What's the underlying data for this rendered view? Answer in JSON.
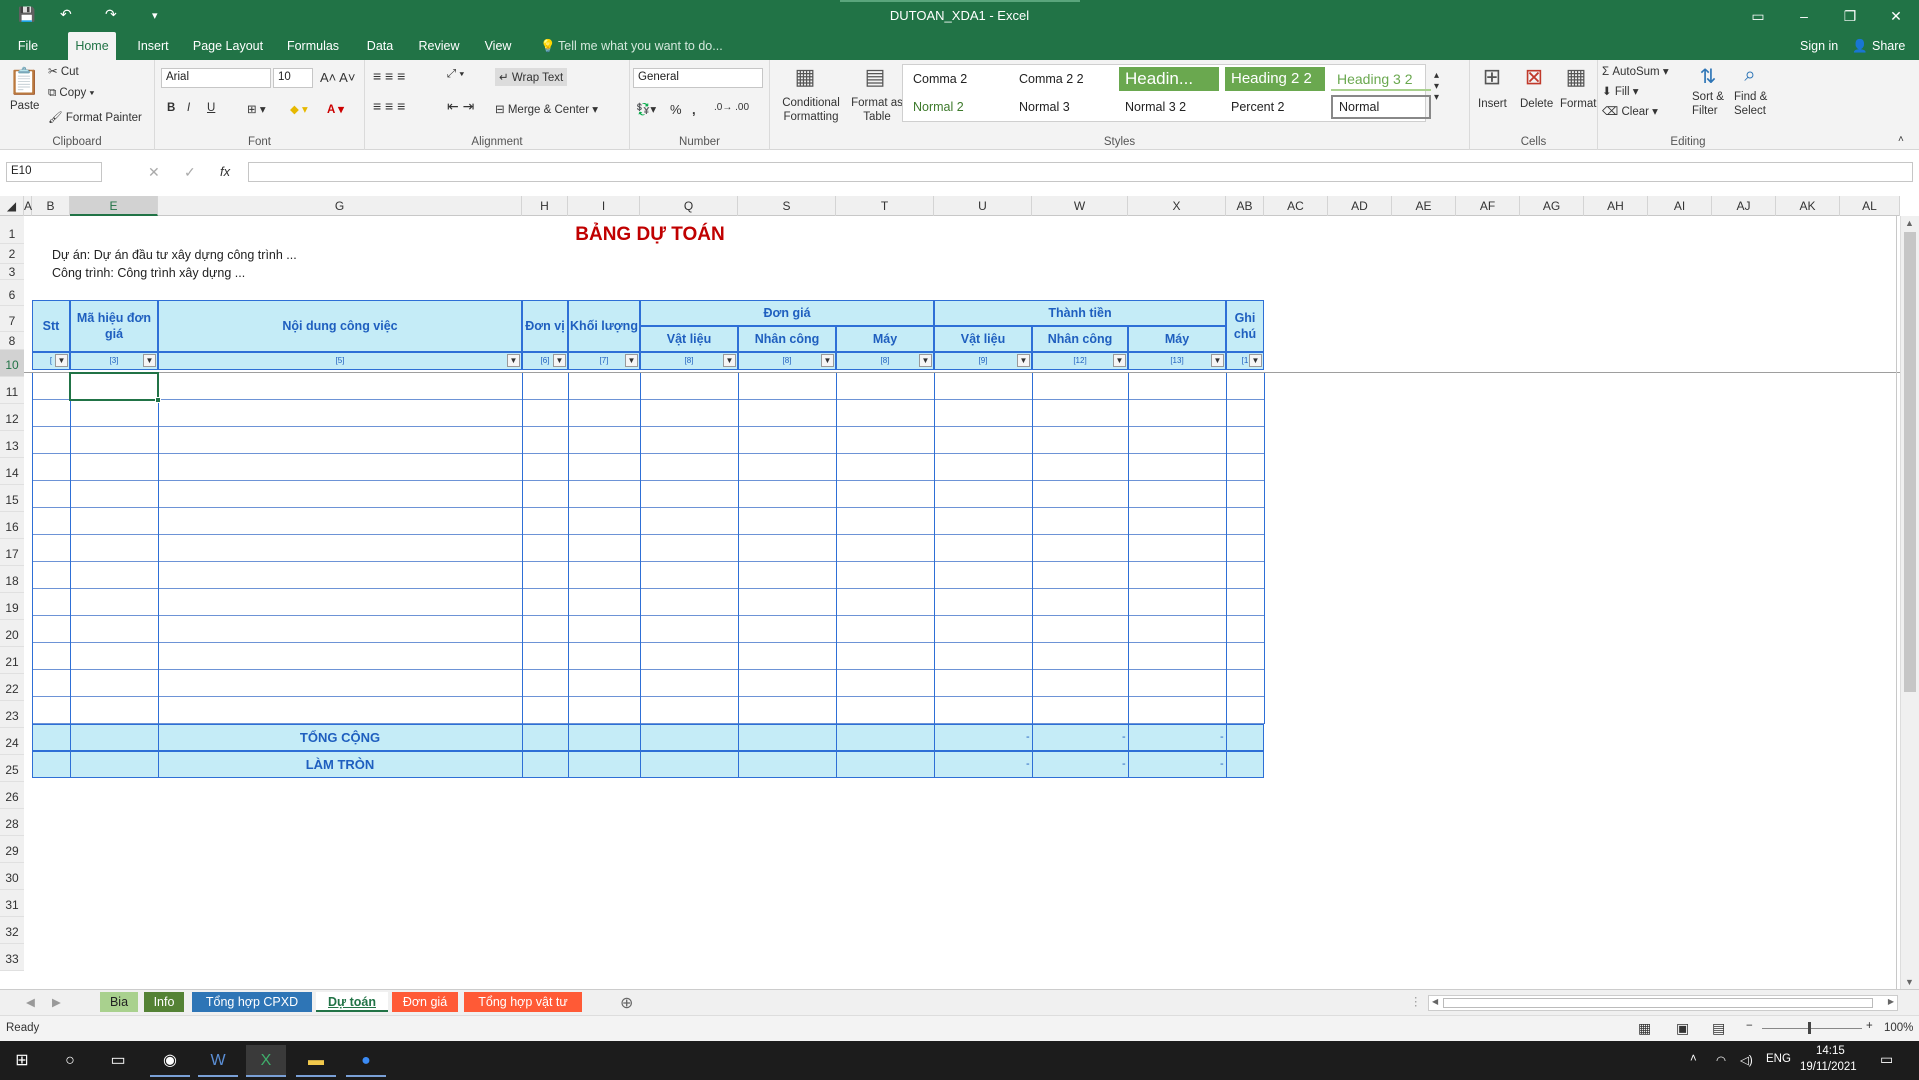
{
  "window": {
    "title": "DUTOAN_XDA1 - Excel",
    "minimize": "–",
    "restore": "❐",
    "close": "✕"
  },
  "quick_access": {
    "save": "💾",
    "undo": "↶",
    "redo": "↷",
    "more": "▾"
  },
  "ribbon_tabs": [
    "File",
    "Home",
    "Insert",
    "Page Layout",
    "Formulas",
    "Data",
    "Review",
    "View"
  ],
  "tell_me": "Tell me what you want to do...",
  "sign_in": "Sign in",
  "share": "Share",
  "clipboard": {
    "paste": "Paste",
    "cut": "Cut",
    "copy": "Copy",
    "format_painter": "Format Painter",
    "label": "Clipboard"
  },
  "font": {
    "name": "Arial",
    "size": "10",
    "label": "Font",
    "bold": "B",
    "italic": "I",
    "underline": "U"
  },
  "alignment": {
    "wrap_text": "Wrap Text",
    "merge_center": "Merge & Center",
    "label": "Alignment"
  },
  "number": {
    "format": "General",
    "percent": "%",
    "comma": ",",
    "label": "Number"
  },
  "styles": {
    "conditional": "Conditional Formatting",
    "format_table": "Format as Table",
    "cells": [
      {
        "label": "Comma 2"
      },
      {
        "label": "Comma 2 2"
      },
      {
        "label": "Headin..."
      },
      {
        "label": "Heading 2 2"
      },
      {
        "label": "Heading 3 2"
      },
      {
        "label": "Normal 2"
      },
      {
        "label": "Normal 3"
      },
      {
        "label": "Normal 3 2"
      },
      {
        "label": "Percent 2"
      },
      {
        "label": "Normal"
      }
    ],
    "label": "Styles"
  },
  "cells_group": {
    "insert": "Insert",
    "delete": "Delete",
    "format": "Format",
    "label": "Cells"
  },
  "editing": {
    "autosum": "AutoSum",
    "fill": "Fill",
    "clear": "Clear",
    "sort_filter": "Sort & Filter",
    "find_select": "Find & Select",
    "label": "Editing"
  },
  "formula_bar": {
    "name_box": "E10",
    "fx": "fx",
    "cancel": "✕",
    "enter": "✓",
    "formula": ""
  },
  "columns": [
    "A",
    "B",
    "E",
    "G",
    "H",
    "I",
    "Q",
    "S",
    "T",
    "U",
    "W",
    "X",
    "AB",
    "AC",
    "AD",
    "AE",
    "AF",
    "AG",
    "AH",
    "AI",
    "AJ",
    "AK",
    "AL"
  ],
  "rows": [
    "1",
    "2",
    "3",
    "6",
    "7",
    "8",
    "10",
    "11",
    "12",
    "13",
    "14",
    "15",
    "16",
    "17",
    "18",
    "19",
    "20",
    "21",
    "22",
    "23",
    "24",
    "25",
    "26",
    "28",
    "29",
    "30",
    "31",
    "32",
    "33"
  ],
  "sheet": {
    "title": "BẢNG DỰ TOÁN",
    "project": "Dự án: Dự án đầu tư xây dựng công trình ...",
    "construction": "Công trình: Công trình xây dựng ...",
    "headers": {
      "stt": "Stt",
      "ma_hieu": "Mã hiệu đơn giá",
      "noi_dung": "Nội dung công việc",
      "don_vi": "Đơn vị",
      "khoi_luong": "Khối lượng",
      "don_gia": "Đơn giá",
      "thanh_tien": "Thành tiền",
      "ghi_chu": "Ghi chú",
      "vat_lieu": "Vật liệu",
      "nhan_cong": "Nhân công",
      "may": "Máy"
    },
    "filter_row": [
      "[",
      "[3]",
      "[5]",
      "[6]",
      "[7]",
      "[8]",
      "[8]",
      "[8]",
      "[9]",
      "[12]",
      "[13]",
      "[1"
    ],
    "total": "TỔNG CỘNG",
    "rounded": "LÀM TRÒN",
    "dash": "-"
  },
  "sheet_tabs": [
    {
      "label": "Bia",
      "color": "#a9d18e"
    },
    {
      "label": "Info",
      "color": "#548235"
    },
    {
      "label": "Tổng hợp CPXD",
      "color": "#2e75b6"
    },
    {
      "label": "Dự toán",
      "color": "#ffffff"
    },
    {
      "label": "Đơn giá",
      "color": "#ff5a36"
    },
    {
      "label": "Tổng hợp vật tư",
      "color": "#ff5a36"
    }
  ],
  "status": {
    "ready": "Ready",
    "zoom": "100%"
  },
  "taskbar": {
    "lang": "ENG",
    "time": "14:15",
    "date": "19/11/2021"
  }
}
